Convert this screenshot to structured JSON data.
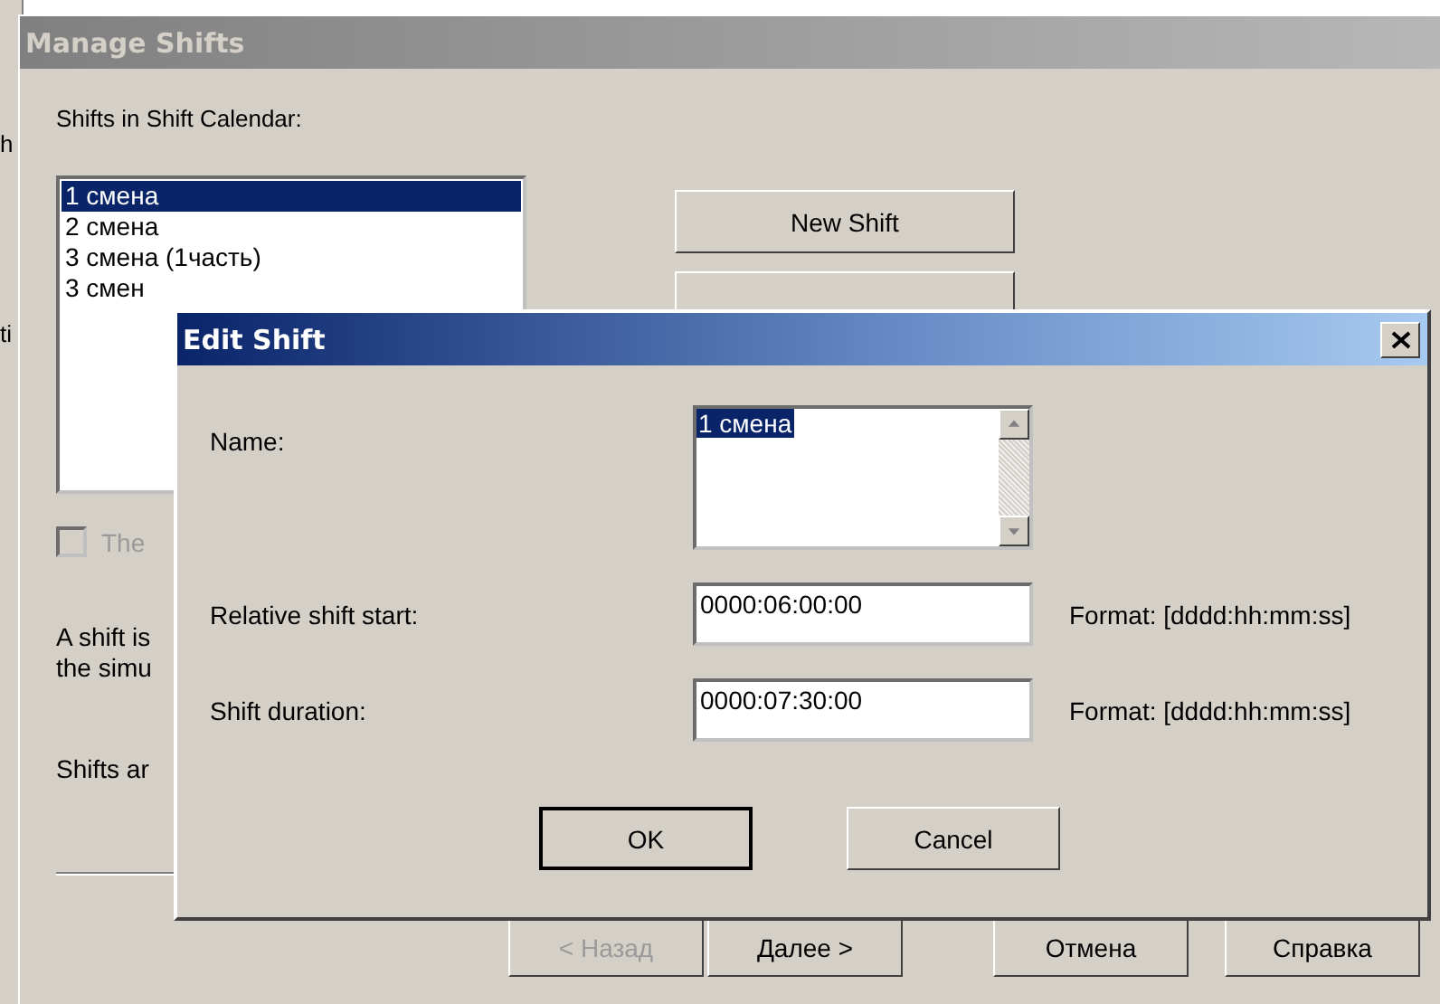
{
  "background_window": {
    "fragments": [
      "h",
      "ti"
    ]
  },
  "manage_window": {
    "title": "Manage Shifts",
    "active": false,
    "list_label": "Shifts in Shift Calendar:",
    "shifts": [
      {
        "label": "1 смена",
        "selected": true
      },
      {
        "label": "2 смена",
        "selected": false
      },
      {
        "label": "3 смена (1часть)",
        "selected": false
      },
      {
        "label": "3 смен",
        "selected": false
      }
    ],
    "side_buttons": [
      "New Shift"
    ],
    "checkbox": {
      "label": "The",
      "checked": false,
      "disabled": true
    },
    "paragraphs": [
      [
        "A shift is",
        "the simu"
      ],
      [
        "Shifts ar"
      ]
    ],
    "wizard_buttons": [
      {
        "label": "< Назад",
        "disabled": true
      },
      {
        "label": "Далее >",
        "disabled": false
      },
      {
        "label": "Отмена",
        "disabled": false
      },
      {
        "label": "Справка",
        "disabled": false
      }
    ]
  },
  "edit_dialog": {
    "title": "Edit Shift",
    "active": true,
    "fields": [
      {
        "kind": "multiline",
        "label": "Name:",
        "value": "1 смена",
        "value_selected": true
      },
      {
        "kind": "line",
        "label": "Relative shift start:",
        "value": "0000:06:00:00",
        "hint": "Format: [dddd:hh:mm:ss]"
      },
      {
        "kind": "line",
        "label": "Shift duration:",
        "value": "0000:07:30:00",
        "hint": "Format: [dddd:hh:mm:ss]"
      }
    ],
    "buttons": [
      {
        "label": "OK",
        "default": true
      },
      {
        "label": "Cancel",
        "default": false
      }
    ]
  }
}
